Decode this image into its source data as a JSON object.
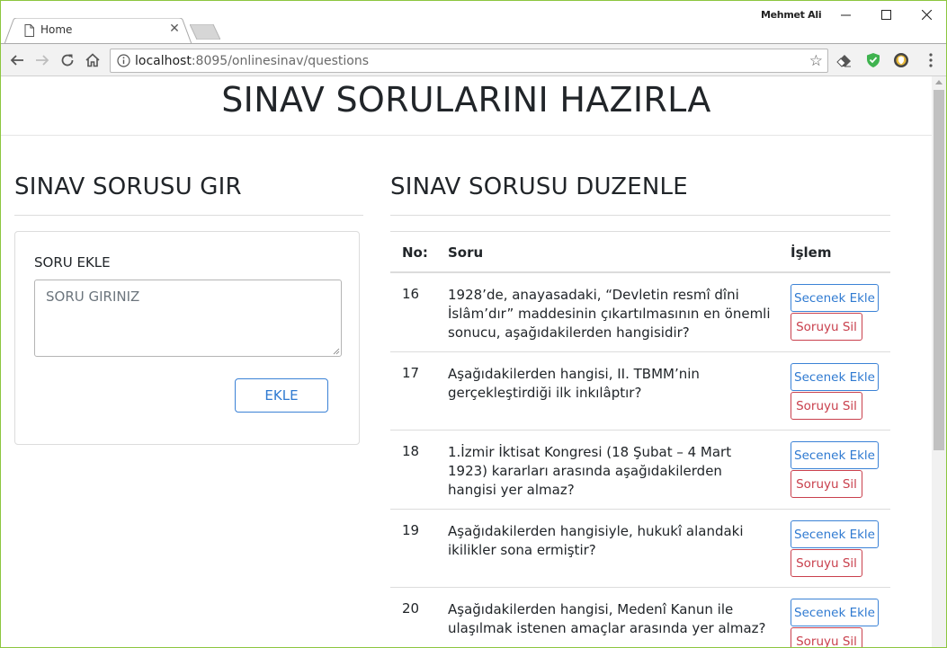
{
  "browser": {
    "tab_title": "Home",
    "user_name": "Mehmet Ali",
    "url_host": "localhost",
    "url_rest": ":8095/onlinesinav/questions"
  },
  "page": {
    "title": "SINAV SORULARINI HAZIRLA"
  },
  "left": {
    "title": "SINAV SORUSU GIR",
    "label": "SORU EKLE",
    "placeholder": "SORU GIRINIZ",
    "button": "EKLE"
  },
  "right": {
    "title": "SINAV SORUSU DUZENLE",
    "headers": {
      "no": "No:",
      "soru": "Soru",
      "islem": "İşlem"
    },
    "add_option_label": "Secenek Ekle",
    "delete_label": "Soruyu Sil",
    "rows": [
      {
        "no": "16",
        "question": "1928’de, anayasadaki, “Devletin resmî dîni İslâm’dır” maddesinin çıkartılmasının en önemli sonucu, aşağıdakilerden hangisidir?",
        "secenek": "Secenek Ekle",
        "sil": "Soruyu Sil"
      },
      {
        "no": "17",
        "question": "Aşağıdakilerden hangisi, II. TBMM’nin gerçekleştirdiği ilk inkılâptır?",
        "secenek": "Secenek Ekle",
        "sil": "Soruyu Sil"
      },
      {
        "no": "18",
        "question": "1.İzmir İktisat Kongresi (18 Şubat – 4 Mart 1923) kararları arasında aşağıdakilerden hangisi yer almaz?",
        "secenek": "Secenek Ekle",
        "sil": "Soruyu Sil"
      },
      {
        "no": "19",
        "question": "Aşağıdakilerden hangisiyle, hukukî alandaki ikilikler sona ermiştir?",
        "secenek": "Secenek Ekle",
        "sil": "Soruyu Sil"
      },
      {
        "no": "20",
        "question": "Aşağıdakilerden hangisi, Medenî Kanun ile ulaşılmak istenen amaçlar arasında yer almaz?",
        "secenek": "Secenek Ekle",
        "sil": "Soruyu Sil"
      }
    ]
  },
  "icons": {
    "page": "page-icon",
    "close": "close-icon",
    "back": "back-arrow-icon",
    "forward": "forward-arrow-icon",
    "reload": "reload-icon",
    "home": "home-icon",
    "info": "info-icon",
    "star": "star-icon",
    "eraser": "eraser-icon",
    "shield": "shield-icon",
    "extension": "extension-icon",
    "menu": "menu-icon"
  }
}
